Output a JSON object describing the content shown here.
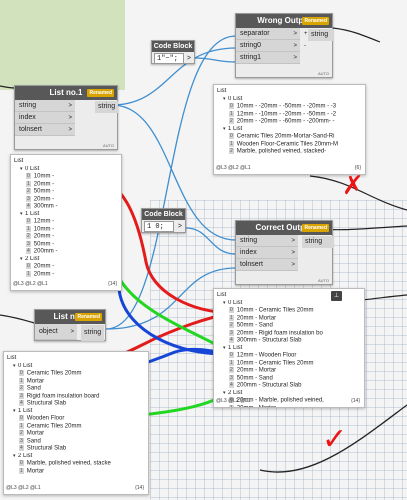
{
  "nodes": {
    "wrong_output": {
      "title": "Wrong Output",
      "badge": "Renamed",
      "inputs": [
        "separator",
        "string0",
        "string1"
      ],
      "output": "string",
      "footer": "AUTO"
    },
    "code_block_top": {
      "title": "Code Block",
      "code": "1\"~\";",
      "out_symbol": ">"
    },
    "list1": {
      "title": "List no.1",
      "badge": "Renamed",
      "inputs": [
        "string",
        "index",
        "tolnsert"
      ],
      "output": "string",
      "footer": "AUTO"
    },
    "code_block_mid": {
      "title": "Code Block",
      "code": "1 0;",
      "out_symbol": ">"
    },
    "correct_output": {
      "title": "Correct Output",
      "badge": "Renamed",
      "inputs": [
        "string",
        "index",
        "tolnsert"
      ],
      "output": "string",
      "footer": "AUTO"
    },
    "list2": {
      "title": "List no.2",
      "badge": "Renamed",
      "inputs": [
        "object"
      ],
      "output": "string"
    }
  },
  "previews": {
    "wrong": {
      "rows": [
        {
          "d": 0,
          "t": "List"
        },
        {
          "d": 1,
          "t": "0 List"
        },
        {
          "d": 2,
          "i": "0",
          "t": "10mm - -20mm - -50mm - -20mm - -3"
        },
        {
          "d": 2,
          "i": "1",
          "t": "12mm - -10mm - -20mm - -50mm - -2"
        },
        {
          "d": 2,
          "i": "2",
          "t": "20mm - -20mm - -60mm - -200mm- -"
        },
        {
          "d": 1,
          "t": "1 List"
        },
        {
          "d": 2,
          "i": "0",
          "t": "Ceramic Tiles 20mm-Mortar-Sand-Ri"
        },
        {
          "d": 2,
          "i": "1",
          "t": "Wooden Floor-Ceramic Tiles 20mm-M"
        },
        {
          "d": 2,
          "i": "2",
          "t": "Marble, polished veined, stacked-"
        }
      ],
      "levels": "@L3 @L2 @L1",
      "count": "{6}"
    },
    "list1": {
      "rows": [
        {
          "d": 0,
          "t": "List"
        },
        {
          "d": 1,
          "t": "0 List"
        },
        {
          "d": 2,
          "i": "0",
          "t": "10mm -"
        },
        {
          "d": 2,
          "i": "1",
          "t": "20mm -"
        },
        {
          "d": 2,
          "i": "2",
          "t": "50mm -"
        },
        {
          "d": 2,
          "i": "3",
          "t": "20mm -"
        },
        {
          "d": 2,
          "i": "4",
          "t": "300mm -"
        },
        {
          "d": 1,
          "t": "1 List"
        },
        {
          "d": 2,
          "i": "0",
          "t": "12mm -"
        },
        {
          "d": 2,
          "i": "1",
          "t": "10mm -"
        },
        {
          "d": 2,
          "i": "2",
          "t": "20mm -"
        },
        {
          "d": 2,
          "i": "3",
          "t": "50mm -"
        },
        {
          "d": 2,
          "i": "4",
          "t": "200mm -"
        },
        {
          "d": 1,
          "t": "2 List"
        },
        {
          "d": 2,
          "i": "0",
          "t": "20mm -"
        },
        {
          "d": 2,
          "i": "1",
          "t": "20mm -"
        }
      ],
      "levels": "@L3 @L2 @L1",
      "count": "{14}"
    },
    "correct": {
      "rows": [
        {
          "d": 0,
          "t": "List"
        },
        {
          "d": 1,
          "t": "0 List"
        },
        {
          "d": 2,
          "i": "0",
          "t": "10mm - Ceramic Tiles 20mm"
        },
        {
          "d": 2,
          "i": "1",
          "t": "20mm - Mortar"
        },
        {
          "d": 2,
          "i": "2",
          "t": "50mm - Sand"
        },
        {
          "d": 2,
          "i": "3",
          "t": "20mm - Rigid foam insulation bo"
        },
        {
          "d": 2,
          "i": "4",
          "t": "300mm - Structural Slab"
        },
        {
          "d": 1,
          "t": "1 List"
        },
        {
          "d": 2,
          "i": "0",
          "t": "12mm - Wooden Floor"
        },
        {
          "d": 2,
          "i": "1",
          "t": "10mm - Ceramic Tiles 20mm"
        },
        {
          "d": 2,
          "i": "2",
          "t": "20mm - Mortar"
        },
        {
          "d": 2,
          "i": "3",
          "t": "50mm - Sand"
        },
        {
          "d": 2,
          "i": "4",
          "t": "200mm - Structural Slab"
        },
        {
          "d": 1,
          "t": "2 List"
        },
        {
          "d": 2,
          "i": "0",
          "t": "20mm - Marble, polished veined,"
        },
        {
          "d": 2,
          "i": "1",
          "t": "20mm - Mortar"
        }
      ],
      "levels": "@L3 @L2 @L1",
      "count": "{14}"
    },
    "list2": {
      "rows": [
        {
          "d": 0,
          "t": "List"
        },
        {
          "d": 1,
          "t": "0 List"
        },
        {
          "d": 2,
          "i": "0",
          "t": "Ceramic Tiles 20mm"
        },
        {
          "d": 2,
          "i": "1",
          "t": "Mortar"
        },
        {
          "d": 2,
          "i": "2",
          "t": "Sand"
        },
        {
          "d": 2,
          "i": "3",
          "t": "Rigid foam insulation board"
        },
        {
          "d": 2,
          "i": "4",
          "t": "Structural Slab"
        },
        {
          "d": 1,
          "t": "1 List"
        },
        {
          "d": 2,
          "i": "0",
          "t": "Wooden Floor"
        },
        {
          "d": 2,
          "i": "1",
          "t": "Ceramic Tiles 20mm"
        },
        {
          "d": 2,
          "i": "2",
          "t": "Mortar"
        },
        {
          "d": 2,
          "i": "3",
          "t": "Sand"
        },
        {
          "d": 2,
          "i": "4",
          "t": "Structural Slab"
        },
        {
          "d": 1,
          "t": "2 List"
        },
        {
          "d": 2,
          "i": "0",
          "t": "Marble, polished veined, stacke"
        },
        {
          "d": 2,
          "i": "1",
          "t": "Mortar"
        }
      ],
      "levels": "@L3 @L2 @L1",
      "count": "{14}"
    }
  },
  "marks": {
    "wrong": "✗",
    "correct": "✓"
  },
  "colors": {
    "wire_default": "#3f8fd0",
    "wire_dark": "#222222",
    "red": "#e41b1b",
    "blue": "#1746d6",
    "green": "#22d622",
    "badge": "#d9a400",
    "header": "#585858"
  }
}
